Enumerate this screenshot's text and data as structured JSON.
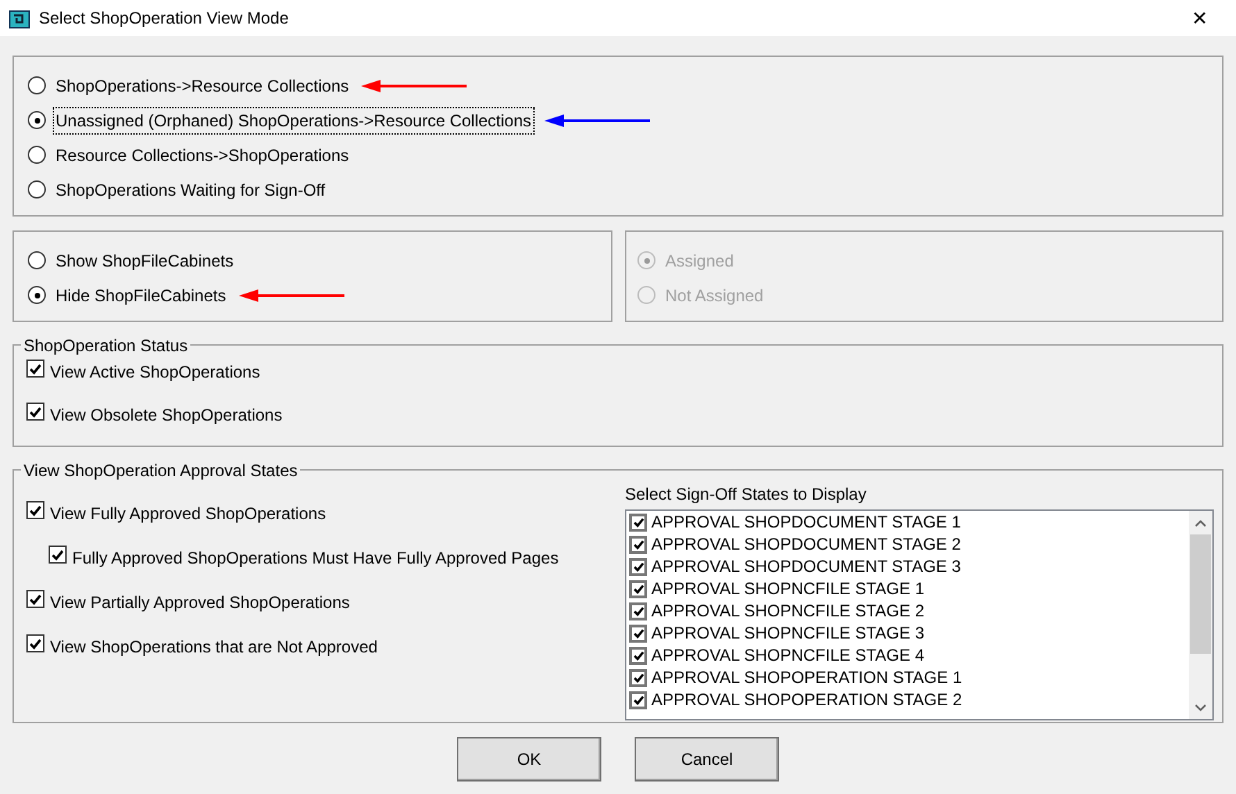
{
  "window": {
    "title": "Select ShopOperation View Mode",
    "close": "✕"
  },
  "view_mode": [
    {
      "label": "ShopOperations->Resource Collections",
      "selected": false,
      "focused": false,
      "arrow": {
        "color": "#ff0000"
      }
    },
    {
      "label": "Unassigned (Orphaned) ShopOperations->Resource Collections",
      "selected": true,
      "focused": true,
      "arrow": {
        "color": "#0000ff"
      }
    },
    {
      "label": "Resource Collections->ShopOperations",
      "selected": false,
      "focused": false
    },
    {
      "label": "ShopOperations Waiting for Sign-Off",
      "selected": false,
      "focused": false
    }
  ],
  "file_cabinets": [
    {
      "label": "Show ShopFileCabinets",
      "selected": false
    },
    {
      "label": "Hide ShopFileCabinets",
      "selected": true,
      "arrow": {
        "color": "#ff0000"
      }
    }
  ],
  "assignment": [
    {
      "label": "Assigned",
      "selected": true,
      "disabled": true
    },
    {
      "label": "Not Assigned",
      "selected": false,
      "disabled": true
    }
  ],
  "status_group": {
    "title": "ShopOperation Status",
    "options": [
      {
        "label": "View Active ShopOperations",
        "checked": true
      },
      {
        "label": "View Obsolete ShopOperations",
        "checked": true
      }
    ]
  },
  "approval_group": {
    "title": "View ShopOperation Approval States",
    "options": [
      {
        "label": "View Fully Approved ShopOperations",
        "checked": true,
        "children": [
          {
            "label": "Fully Approved ShopOperations Must Have Fully Approved Pages",
            "checked": true
          }
        ]
      },
      {
        "label": "View Partially Approved ShopOperations",
        "checked": true
      },
      {
        "label": "View ShopOperations that are Not Approved",
        "checked": true
      }
    ],
    "list_label": "Select Sign-Off States to Display",
    "sign_off_states": [
      {
        "label": "APPROVAL SHOPDOCUMENT STAGE 1",
        "checked": true
      },
      {
        "label": "APPROVAL SHOPDOCUMENT STAGE 2",
        "checked": true
      },
      {
        "label": "APPROVAL SHOPDOCUMENT STAGE 3",
        "checked": true
      },
      {
        "label": "APPROVAL SHOPNCFILE STAGE 1",
        "checked": true
      },
      {
        "label": "APPROVAL SHOPNCFILE STAGE 2",
        "checked": true
      },
      {
        "label": "APPROVAL SHOPNCFILE STAGE 3",
        "checked": true
      },
      {
        "label": "APPROVAL SHOPNCFILE STAGE 4",
        "checked": true
      },
      {
        "label": "APPROVAL SHOPOPERATION STAGE 1",
        "checked": true
      },
      {
        "label": "APPROVAL SHOPOPERATION STAGE 2",
        "checked": true
      }
    ]
  },
  "buttons": [
    "OK",
    "Cancel"
  ]
}
